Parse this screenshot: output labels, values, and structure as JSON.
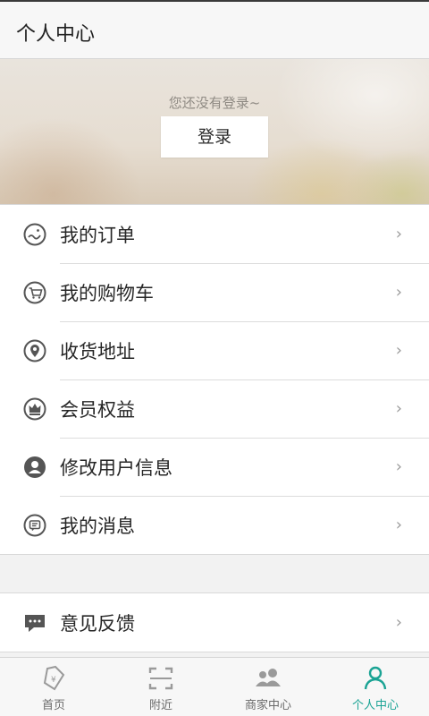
{
  "header": {
    "title": "个人中心"
  },
  "banner": {
    "hint": "您还没有登录~",
    "login_label": "登录"
  },
  "menu_main": [
    {
      "label": "我的订单",
      "icon": "order-icon"
    },
    {
      "label": "我的购物车",
      "icon": "cart-icon"
    },
    {
      "label": "收货地址",
      "icon": "location-pin-icon"
    },
    {
      "label": "会员权益",
      "icon": "crown-icon"
    },
    {
      "label": "修改用户信息",
      "icon": "user-profile-icon"
    },
    {
      "label": "我的消息",
      "icon": "message-icon"
    }
  ],
  "menu_secondary": [
    {
      "label": "意见反馈",
      "icon": "feedback-icon"
    }
  ],
  "chevron": "›",
  "tabbar": {
    "tabs": [
      {
        "label": "首页",
        "icon": "home-price-tag-icon",
        "active": false
      },
      {
        "label": "附近",
        "icon": "scan-frame-icon",
        "active": false
      },
      {
        "label": "商家中心",
        "icon": "merchants-people-icon",
        "active": false
      },
      {
        "label": "个人中心",
        "icon": "person-icon",
        "active": true
      }
    ],
    "active_color": "#1aa394",
    "inactive_color": "#9a9a9a"
  }
}
